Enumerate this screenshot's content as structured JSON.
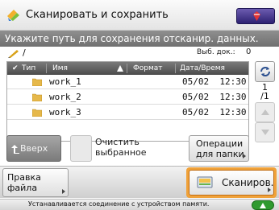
{
  "header": {
    "title": "Сканировать и сохранить",
    "instruction": "Укажите путь для сохранения отсканир. данных."
  },
  "path": {
    "current": "/",
    "selected_label": "Выб. док.:",
    "selected_count": "0"
  },
  "table": {
    "columns": [
      "Тип",
      "Имя",
      "Формат",
      "Дата/Время"
    ],
    "rows": [
      {
        "type": "folder-icon",
        "name": "work_1",
        "date": "05/02  12:30"
      },
      {
        "type": "folder-icon",
        "name": "work_2",
        "date": "05/02  12:30"
      },
      {
        "type": "folder-icon",
        "name": "work_3",
        "date": "05/02  12:30"
      }
    ]
  },
  "pager": {
    "current": "1",
    "total": "/1"
  },
  "buttons": {
    "up": "Вверх",
    "clear_line1": "Очистить",
    "clear_line2": "выбранное",
    "ops_line1": "Операции",
    "ops_line2": "для папки",
    "edit_line1": "Правка",
    "edit_line2": "файла",
    "scan": "Сканиров."
  },
  "status": {
    "text": "Устанавливается соединение с устройством памяти."
  },
  "colors": {
    "scan_highlight": "#f0a23a",
    "header_bar": "#7a7a7a",
    "status_icon": "#2f9a2f"
  }
}
